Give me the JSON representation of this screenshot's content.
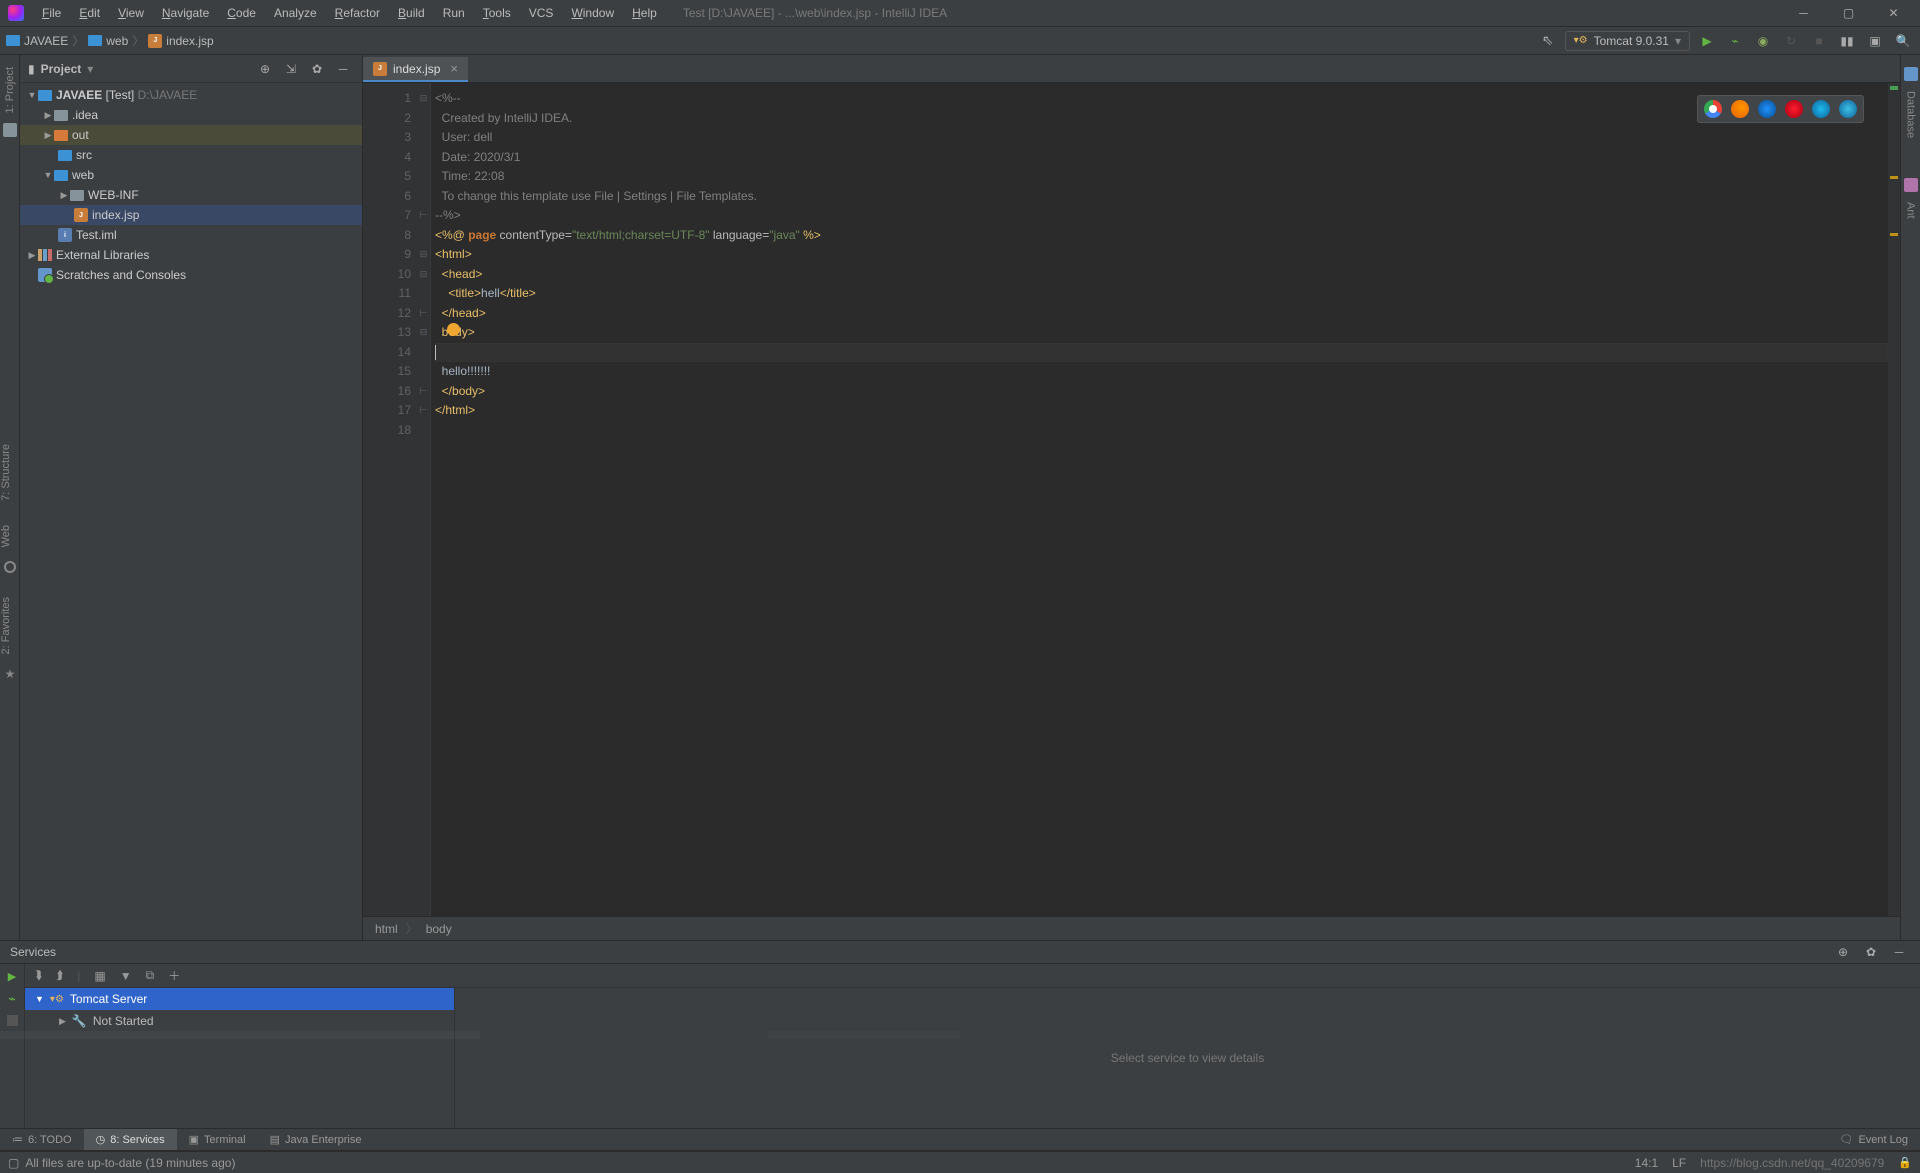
{
  "menu": [
    "File",
    "Edit",
    "View",
    "Navigate",
    "Code",
    "Analyze",
    "Refactor",
    "Build",
    "Run",
    "Tools",
    "VCS",
    "Window",
    "Help"
  ],
  "windowTitle": "Test [D:\\JAVAEE] - ...\\web\\index.jsp - IntelliJ IDEA",
  "breadcrumb": {
    "root": "JAVAEE",
    "mid": "web",
    "file": "index.jsp"
  },
  "runConfig": "Tomcat 9.0.31",
  "project": {
    "title": "Project",
    "rootName": "JAVAEE",
    "rootTag": "[Test]",
    "rootPath": "D:\\JAVAEE",
    "idea": ".idea",
    "out": "out",
    "src": "src",
    "web": "web",
    "webinf": "WEB-INF",
    "indexjsp": "index.jsp",
    "iml": "Test.iml",
    "ext": "External Libraries",
    "scratch": "Scratches and Consoles"
  },
  "editorTab": "index.jsp",
  "code": {
    "l1": "<%--",
    "l2": "  Created by IntelliJ IDEA.",
    "l3": "  User: dell",
    "l4": "  Date: 2020/3/1",
    "l5": "  Time: 22:08",
    "l6": "  To change this template use File | Settings | File Templates.",
    "l7": "--%>",
    "l8a": "<%@ ",
    "l8b": "page",
    "l8c": " contentType=",
    "l8d": "\"text/html;charset=UTF-8\"",
    "l8e": " language=",
    "l8f": "\"java\"",
    "l8g": " %>",
    "l9a": "<",
    "l9b": "html",
    "l9c": ">",
    "l10a": "<",
    "l10b": "head",
    "l10c": ">",
    "l11a": "    <",
    "l11b": "title",
    "l11c": ">",
    "l11d": "hell",
    "l11e": "</",
    "l11f": "title",
    "l11g": ">",
    "l12a": "</",
    "l12b": "head",
    "l12c": ">",
    "l13a": "body",
    "l13b": ">",
    "l15": "hello!!!!!!!",
    "l16a": "</",
    "l16b": "body",
    "l16c": ">",
    "l17a": "</",
    "l17b": "html",
    "l17c": ">"
  },
  "bcBottom": {
    "html": "html",
    "body": "body"
  },
  "services": {
    "title": "Services",
    "root": "Tomcat Server",
    "child": "Not Started",
    "detail": "Select service to view details"
  },
  "bottomTabs": {
    "todo": "6: TODO",
    "services": "8: Services",
    "terminal": "Terminal",
    "je": "Java Enterprise",
    "eventLog": "Event Log"
  },
  "status": {
    "msg": "All files are up-to-date (19 minutes ago)",
    "pos": "14:1",
    "enc": "LF",
    "watermark": "https://blog.csdn.net/qq_40209679"
  },
  "rightTabs": {
    "db": "Database",
    "ant": "Ant"
  },
  "leftTabs": {
    "project": "1: Project",
    "structure": "7: Structure",
    "favorites": "2: Favorites",
    "web": "Web"
  }
}
